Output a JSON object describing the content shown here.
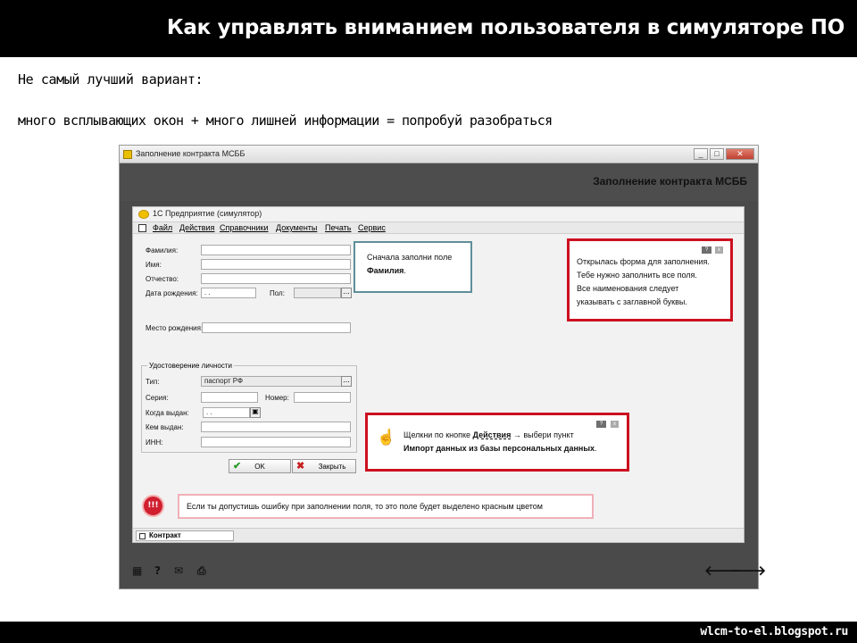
{
  "header": {
    "title": "Как управлять вниманием пользователя в симуляторе ПО"
  },
  "intro": {
    "line1": "Не самый лучший вариант:",
    "line2": "много всплывающих окон + много лишней информации = попробуй разобраться"
  },
  "window": {
    "title": "Заполнение контракта МСББ",
    "header_title": "Заполнение контракта МСББ",
    "controls": [
      "_",
      "□",
      "✕"
    ]
  },
  "inner_app": {
    "title": "1С Предприятие (симулятор)",
    "menu": [
      "Файл",
      "Действия",
      "Справочники",
      "Документы",
      "Печать",
      "Сервис"
    ]
  },
  "form": {
    "labels": {
      "surname": "Фамилия:",
      "name": "Имя:",
      "patronymic": "Отчество:",
      "birthdate": "Дата рождения:",
      "gender": "Пол:",
      "birthplace": "Место рождения:",
      "id_group": "Удостоверение личности",
      "doc_type": "Тип:",
      "series": "Серия:",
      "number": "Номер:",
      "issued_when": "Когда выдан:",
      "issued_by": "Кем выдан:",
      "inn": "ИНН:"
    },
    "values": {
      "birthdate": " .  .",
      "doc_type": "паспорт РФ",
      "issued_when": " .  ."
    },
    "buttons": {
      "ok": "OK",
      "close": "Закрыть"
    }
  },
  "tips": {
    "hint_prefix": "Сначала заполни поле ",
    "hint_bold": "Фамилия",
    "hint_suffix": ".",
    "info_lines": [
      "Открылась форма для заполнения.",
      "Тебе нужно заполнить все поля.",
      "Все наименования следует",
      "указывать с заглавной буквы."
    ],
    "action_prefix": "Щелкни по кнопке ",
    "action_bold": "Действия",
    "action_mid": " → выбери пункт",
    "action_bold2": "Импорт данных из базы персональных данных",
    "action_suffix": ".",
    "error_text": "Если ты допустишь ошибку при заполнении поля, то это поле будет выделено красным цветом",
    "badge_q": "?",
    "badge_x": "x",
    "warn_icon": "!!!"
  },
  "tab": {
    "label": "Контракт"
  },
  "footer": {
    "icons": [
      "grid-icon",
      "help-icon",
      "mail-icon",
      "print-icon",
      "arrow-left-icon",
      "arrow-right-icon"
    ]
  },
  "site": {
    "url": "wlcm-to-el.blogspot.ru"
  },
  "colors": {
    "tip_border": "#5f8f9a",
    "red_border": "#cc1020",
    "window_dark": "#4a4a4a"
  }
}
